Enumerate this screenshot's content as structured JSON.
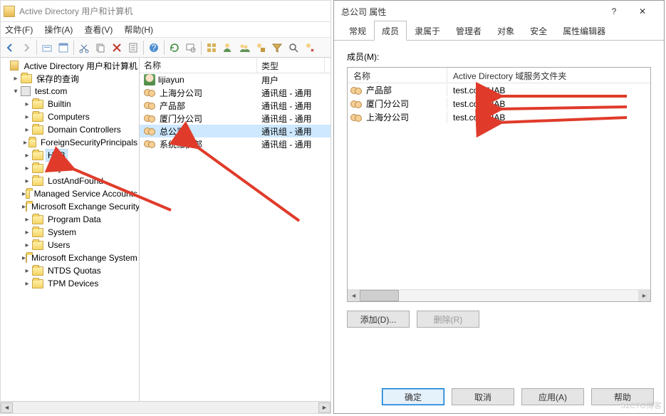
{
  "aduc": {
    "title": "Active Directory 用户和计算机",
    "menus": [
      "文件(F)",
      "操作(A)",
      "查看(V)",
      "帮助(H)"
    ],
    "tree": {
      "root": "Active Directory 用户和计算机",
      "savedQueries": "保存的查询",
      "domain": "test.com",
      "nodes": [
        "Builtin",
        "Computers",
        "Domain Controllers",
        "ForeignSecurityPrincipals",
        "HAB",
        "Keys",
        "LostAndFound",
        "Managed Service Accounts",
        "Microsoft Exchange Security Groups",
        "Program Data",
        "System",
        "Users",
        "Microsoft Exchange System Objects",
        "NTDS Quotas",
        "TPM Devices"
      ],
      "selected": "HAB"
    },
    "list": {
      "cols": [
        "名称",
        "类型"
      ],
      "rows": [
        {
          "icon": "usr",
          "name": "lijiayun",
          "type": "用户",
          "sel": false
        },
        {
          "icon": "grp",
          "name": "上海分公司",
          "type": "通讯组 - 通用",
          "sel": false
        },
        {
          "icon": "grp",
          "name": "产品部",
          "type": "通讯组 - 通用",
          "sel": false
        },
        {
          "icon": "grp",
          "name": "厦门分公司",
          "type": "通讯组 - 通用",
          "sel": false
        },
        {
          "icon": "grp",
          "name": "总公司",
          "type": "通讯组 - 通用",
          "sel": true
        },
        {
          "icon": "grp",
          "name": "系统维护部",
          "type": "通讯组 - 通用",
          "sel": false
        }
      ]
    }
  },
  "dialog": {
    "title": "总公司 属性",
    "tabs": [
      "常规",
      "成员",
      "隶属于",
      "管理者",
      "对象",
      "安全",
      "属性编辑器"
    ],
    "activeTab": 1,
    "membersLabel": "成员(M):",
    "memberCols": [
      "名称",
      "Active Directory 域服务文件夹"
    ],
    "members": [
      {
        "name": "产品部",
        "folder": "test.com/HAB"
      },
      {
        "name": "厦门分公司",
        "folder": "test.com/HAB"
      },
      {
        "name": "上海分公司",
        "folder": "test.com/HAB"
      }
    ],
    "addBtn": "添加(D)...",
    "removeBtn": "删除(R)",
    "ok": "确定",
    "cancel": "取消",
    "apply": "应用(A)",
    "help": "帮助"
  },
  "watermark": "51CTO博客"
}
